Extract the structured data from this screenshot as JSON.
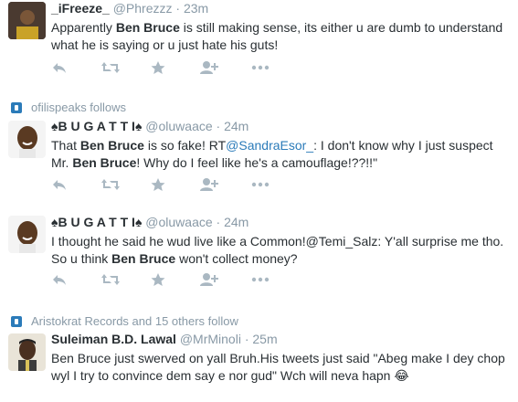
{
  "tweets": [
    {
      "name": "_iFreeze_",
      "handle": "@Phrezzz",
      "time": "23m",
      "body": {
        "p1": "Apparently ",
        "h1": "Ben Bruce",
        "p2": " is still making sense, its either u are dumb to understand what he is saying or u just hate his guts!"
      }
    },
    {
      "context": "ofilispeaks follows",
      "name": "♠B U G A T T I♠",
      "handle": "@oluwaace",
      "time": "24m",
      "body": {
        "p1": "That ",
        "h1": "Ben Bruce",
        "p2": " is so fake! RT",
        "mention": "@SandraEsor_",
        "p3": ": I don't know why I just suspect Mr. ",
        "h2": "Ben Bruce",
        "p4": "! Why do I feel like he's a camouflage!??!!\""
      }
    },
    {
      "name": "♠B U G A T T I♠",
      "handle": "@oluwaace",
      "time": "24m",
      "body": {
        "p1": "I thought he said he wud live like a Common!@Temi_Salz: Y'all surprise me tho. So u think ",
        "h1": "Ben Bruce",
        "p2": " won't collect money?"
      }
    },
    {
      "context": "Aristokrat Records and 15 others follow",
      "name": "Suleiman B.D. Lawal",
      "handle": "@MrMinoli",
      "time": "25m",
      "body": {
        "p1": "Ben Bruce just swerved on yall Bruh.His tweets just said \"Abeg make I dey chop wyl I try to convince dem say e nor gud\" Wch will neva hapn 😂"
      }
    }
  ],
  "icons": [
    "reply-icon",
    "retweet-icon",
    "favorite-icon",
    "follow-icon",
    "more-icon"
  ],
  "colors": {
    "icon": "#aab8c2",
    "meta": "#8899a6",
    "link": "#2b7bb9",
    "text": "#292f33"
  }
}
